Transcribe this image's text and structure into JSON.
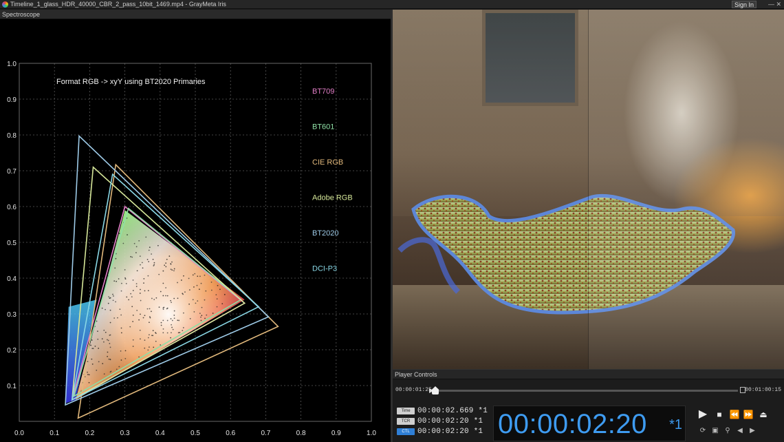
{
  "window": {
    "title": "Timeline_1_glass_HDR_40000_CBR_2_pass_10bit_1469.mp4 - GrayMeta Iris",
    "signin_label": "Sign In",
    "icon": "app-logo-icon"
  },
  "scope": {
    "panel_title": "Spectroscope",
    "chart_title": "Format RGB -> xyY using BT2020 Primaries"
  },
  "chart_data": {
    "type": "scatter",
    "title": "Format RGB -> xyY using BT2020 Primaries",
    "xlim": [
      0.0,
      1.0
    ],
    "ylim": [
      0.0,
      1.0
    ],
    "x_ticks": [
      "0.0",
      "0.1",
      "0.2",
      "0.3",
      "0.4",
      "0.5",
      "0.6",
      "0.7",
      "0.8",
      "0.9",
      "1.0"
    ],
    "y_ticks": [
      "0.0",
      "0.1",
      "0.2",
      "0.3",
      "0.4",
      "0.5",
      "0.6",
      "0.7",
      "0.8",
      "0.9",
      "1.0"
    ],
    "grid": true,
    "legend_position": "right",
    "gamuts": [
      {
        "name": "BT709",
        "color": "#e37fc8",
        "points": [
          [
            0.64,
            0.33
          ],
          [
            0.3,
            0.6
          ],
          [
            0.15,
            0.06
          ]
        ]
      },
      {
        "name": "BT601",
        "color": "#8fe0a6",
        "points": [
          [
            0.63,
            0.34
          ],
          [
            0.31,
            0.595
          ],
          [
            0.155,
            0.07
          ]
        ]
      },
      {
        "name": "CIE RGB",
        "color": "#e2b97c",
        "points": [
          [
            0.735,
            0.265
          ],
          [
            0.274,
            0.717
          ],
          [
            0.167,
            0.009
          ]
        ]
      },
      {
        "name": "Adobe RGB",
        "color": "#d7e89a",
        "points": [
          [
            0.64,
            0.33
          ],
          [
            0.21,
            0.71
          ],
          [
            0.15,
            0.06
          ]
        ]
      },
      {
        "name": "BT2020",
        "color": "#9ecbe8",
        "points": [
          [
            0.708,
            0.292
          ],
          [
            0.17,
            0.797
          ],
          [
            0.131,
            0.046
          ]
        ]
      },
      {
        "name": "DCI-P3",
        "color": "#8ad8e6",
        "points": [
          [
            0.68,
            0.32
          ],
          [
            0.265,
            0.69
          ],
          [
            0.15,
            0.06
          ]
        ]
      }
    ]
  },
  "player": {
    "panel_title": "Player Controls",
    "start_time": "00:00:01:25",
    "end_time": "00:01:00:15",
    "playhead_fraction": 0.0,
    "timecodes": [
      {
        "tag": "Time",
        "value": "00:00:02.669 *1"
      },
      {
        "tag": "TCR",
        "value": "00:00:02:20 *1"
      },
      {
        "tag": "CTL",
        "value": "00:00:02:20 *1"
      }
    ],
    "big_timecode": "00:00:02:20",
    "big_rate": "*1",
    "buttons": [
      "play-icon",
      "stop-icon",
      "rewind-icon",
      "fast-forward-icon",
      "eject-icon"
    ]
  }
}
